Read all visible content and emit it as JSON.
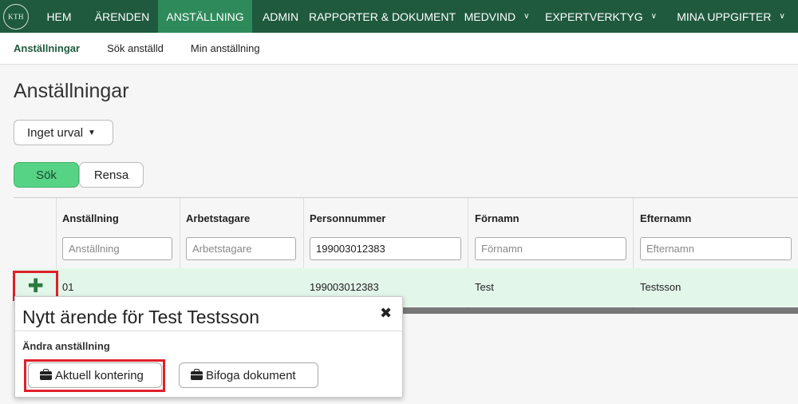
{
  "logo": {
    "text": "KTH"
  },
  "topnav": {
    "items": [
      {
        "label": "HEM"
      },
      {
        "label": "ÄRENDEN"
      },
      {
        "label": "ANSTÄLLNING",
        "active": true
      },
      {
        "label": "ADMIN"
      },
      {
        "label": "RAPPORTER & DOKUMENT"
      },
      {
        "label": "MEDVIND",
        "chevron": true
      },
      {
        "label": "EXPERTVERKTYG",
        "chevron": true
      },
      {
        "label": "MINA UPPGIFTER",
        "chevron": true
      }
    ]
  },
  "subnav": {
    "items": [
      {
        "label": "Anställningar",
        "active": true
      },
      {
        "label": "Sök anställd"
      },
      {
        "label": "Min anställning"
      }
    ]
  },
  "page": {
    "title": "Anställningar"
  },
  "filter_dropdown": {
    "label": "Inget urval"
  },
  "buttons": {
    "search": "Sök",
    "clear": "Rensa"
  },
  "table": {
    "columns": [
      {
        "header": "Anställning",
        "filter_placeholder": "Anställning",
        "filter_value": ""
      },
      {
        "header": "Arbetstagare",
        "filter_placeholder": "Arbetstagare",
        "filter_value": ""
      },
      {
        "header": "Personnummer",
        "filter_placeholder": "Personnummer",
        "filter_value": "199003012383"
      },
      {
        "header": "Förnamn",
        "filter_placeholder": "Förnamn",
        "filter_value": ""
      },
      {
        "header": "Efternamn",
        "filter_placeholder": "Efternamn",
        "filter_value": ""
      }
    ],
    "rows": [
      {
        "anstallning": "01",
        "arbetstagare": "",
        "personnummer": "199003012383",
        "fornamn": "Test",
        "efternamn": "Testsson"
      }
    ]
  },
  "popup": {
    "title": "Nytt ärende för Test Testsson",
    "close_symbol": "✖",
    "section_label": "Ändra anställning",
    "buttons": [
      {
        "label": "Aktuell kontering",
        "icon": "briefcase-icon"
      },
      {
        "label": "Bifoga dokument",
        "icon": "briefcase-icon"
      }
    ]
  },
  "colors": {
    "nav_bg": "#1f5a3e",
    "nav_active": "#2f8a5b",
    "search_button": "#57d386",
    "row_highlight": "#e3f6ea",
    "highlight_frame": "#e0202a"
  }
}
